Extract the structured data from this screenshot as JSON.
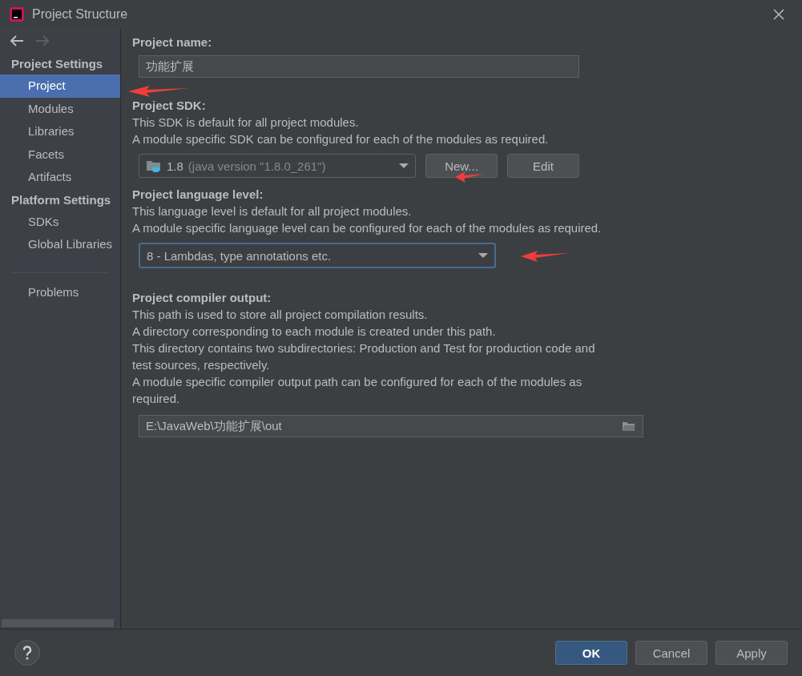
{
  "window": {
    "title": "Project Structure"
  },
  "sidebar": {
    "sections": [
      {
        "heading": "Project Settings",
        "items": [
          {
            "label": "Project",
            "selected": true
          },
          {
            "label": "Modules",
            "selected": false
          },
          {
            "label": "Libraries",
            "selected": false
          },
          {
            "label": "Facets",
            "selected": false
          },
          {
            "label": "Artifacts",
            "selected": false
          }
        ]
      },
      {
        "heading": "Platform Settings",
        "items": [
          {
            "label": "SDKs",
            "selected": false
          },
          {
            "label": "Global Libraries",
            "selected": false
          }
        ]
      }
    ],
    "extra_items": [
      {
        "label": "Problems",
        "selected": false
      }
    ]
  },
  "project_name": {
    "label": "Project name:",
    "value": "功能扩展"
  },
  "project_sdk": {
    "label": "Project SDK:",
    "lines": [
      "This SDK is default for all project modules.",
      "A module specific SDK can be configured for each of the modules as required."
    ],
    "version": "1.8",
    "detail": "(java version \"1.8.0_261\")",
    "buttons": [
      "New...",
      "Edit"
    ]
  },
  "language_level": {
    "label": "Project language level:",
    "lines": [
      "This language level is default for all project modules.",
      "A module specific language level can be configured for each of the modules as required."
    ],
    "value": "8 - Lambdas, type annotations etc."
  },
  "compiler_output": {
    "label": "Project compiler output:",
    "lines": [
      "This path is used to store all project compilation results.",
      "A directory corresponding to each module is created under this path.",
      "This directory contains two subdirectories: Production and Test for production code and test sources, respectively.",
      "A module specific compiler output path can be configured for each of the modules as required."
    ],
    "value": "E:\\JavaWeb\\功能扩展\\out"
  },
  "footer": {
    "buttons": [
      {
        "label": "OK",
        "kind": "primary"
      },
      {
        "label": "Cancel",
        "kind": "normal"
      },
      {
        "label": "Apply",
        "kind": "normal"
      }
    ]
  }
}
